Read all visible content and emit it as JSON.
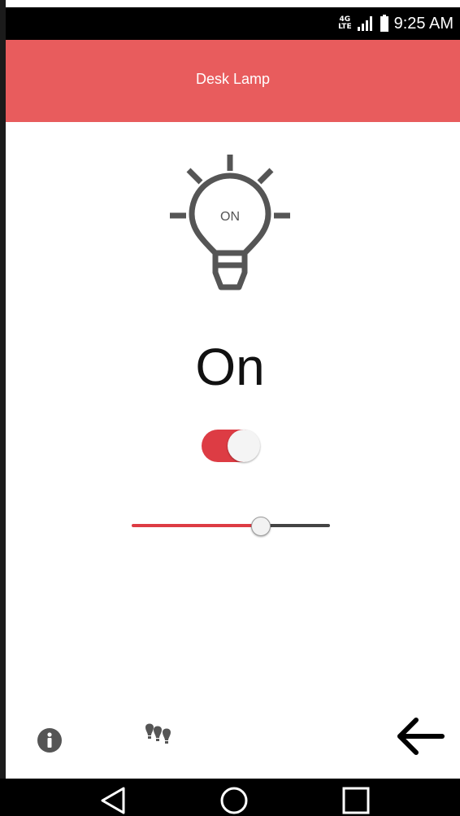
{
  "status_bar": {
    "network_type": "4G LTE",
    "time": "9:25 AM"
  },
  "app_bar": {
    "title": "Desk Lamp"
  },
  "lamp": {
    "bulb_label": "ON",
    "state_text": "On",
    "switch_on": true,
    "brightness_fraction": 0.67
  },
  "colors": {
    "accent": "#e85c5d",
    "toggle_red": "#dd3c44",
    "icon_gray": "#555555"
  },
  "toolbar": {
    "icons": [
      "info-icon",
      "bulbs-icon",
      "arrow-left-icon"
    ]
  },
  "nav_bar": {
    "icons": [
      "back-triangle-icon",
      "home-circle-icon",
      "recents-square-icon"
    ]
  }
}
